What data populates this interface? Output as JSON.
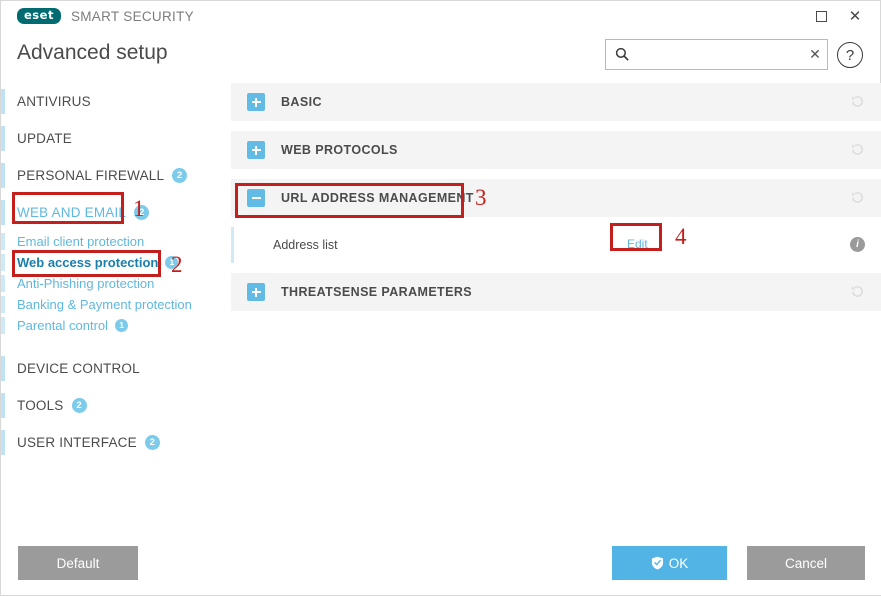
{
  "window": {
    "brand_badge": "eset",
    "suite_name": "SMART SECURITY",
    "maximize_label": "Maximize",
    "close_label": "✕"
  },
  "header": {
    "title": "Advanced setup",
    "search": {
      "value": "",
      "placeholder": "",
      "clear_label": "✕",
      "icon": "search-icon"
    },
    "help_label": "?"
  },
  "sidebar": {
    "items": [
      {
        "label": "ANTIVIRUS",
        "badge": "",
        "type": "top"
      },
      {
        "label": "UPDATE",
        "badge": "",
        "type": "top"
      },
      {
        "label": "PERSONAL FIREWALL",
        "badge": "2",
        "type": "top"
      },
      {
        "label": "WEB AND EMAIL",
        "badge": "2",
        "type": "top",
        "accent": true
      },
      {
        "label": "Email client protection",
        "badge": "",
        "type": "sub"
      },
      {
        "label": "Web access protection",
        "badge": "1",
        "type": "sub",
        "selected": true
      },
      {
        "label": "Anti-Phishing protection",
        "badge": "",
        "type": "sub"
      },
      {
        "label": "Banking & Payment protection",
        "badge": "",
        "type": "sub"
      },
      {
        "label": "Parental control",
        "badge": "1",
        "type": "sub"
      },
      {
        "label": "DEVICE CONTROL",
        "badge": "",
        "type": "top"
      },
      {
        "label": "TOOLS",
        "badge": "2",
        "type": "top"
      },
      {
        "label": "USER INTERFACE",
        "badge": "2",
        "type": "top"
      }
    ]
  },
  "main": {
    "sections": [
      {
        "title": "BASIC",
        "expanded": false
      },
      {
        "title": "WEB PROTOCOLS",
        "expanded": false
      },
      {
        "title": "URL ADDRESS MANAGEMENT",
        "expanded": true
      },
      {
        "title": "THREATSENSE PARAMETERS",
        "expanded": false
      }
    ],
    "address_list_row": {
      "label": "Address list",
      "edit_label": "Edit",
      "info_label": "i"
    }
  },
  "footer": {
    "default_label": "Default",
    "ok_label": "OK",
    "cancel_label": "Cancel"
  },
  "annotations": [
    {
      "number": "1"
    },
    {
      "number": "2"
    },
    {
      "number": "3"
    },
    {
      "number": "4"
    }
  ],
  "colors": {
    "accent_blue": "#5fb8e0",
    "badge_blue": "#7ccbea",
    "annotation_red": "#c3201d",
    "eset_teal": "#006c72",
    "ok_blue": "#51b4e4",
    "gray_button": "#9b9b9b"
  }
}
